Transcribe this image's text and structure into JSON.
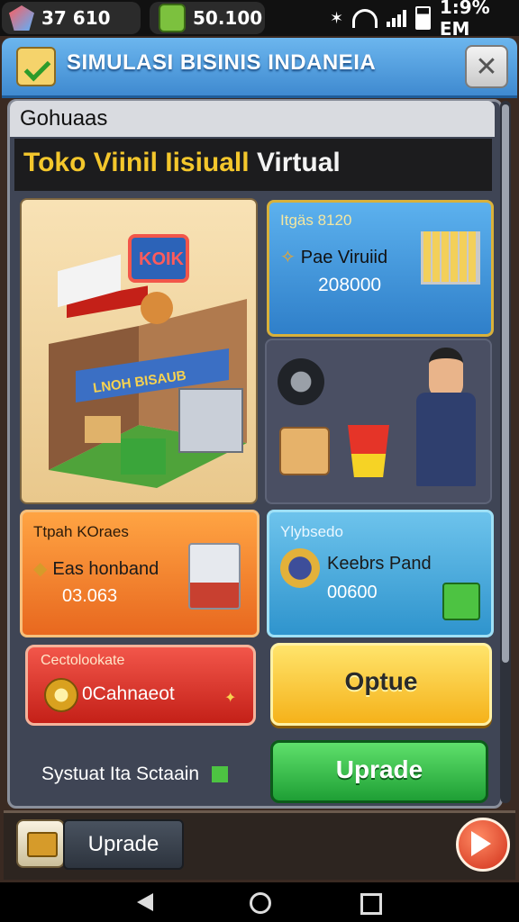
{
  "status_bar": {
    "left_value": "37 610",
    "coins_value": "50.100",
    "time": "1:9% EM"
  },
  "header": {
    "title": "SIMULASI BISINIS INDANEIA",
    "close_icon": "close-icon"
  },
  "panel": {
    "section_label": "Gohuaas",
    "banner_title_yellow": "Toko Viinil Iisiuall",
    "banner_title_white": " Virtual"
  },
  "shop_card": {
    "sign_text": "KOIK",
    "store_sign_text": "LNOH BISAUB"
  },
  "virtual_card": {
    "label": "Itgäs 8120",
    "name": "Pae Viruiid",
    "price": "208000"
  },
  "orange_card": {
    "label": "Ttpah KOraes",
    "name": "Eas honband",
    "value": "03.063"
  },
  "blue_card": {
    "label": "Ylybsedo",
    "name": "Keebrs Pand",
    "value": "00600"
  },
  "red_card": {
    "label": "Cectolookate",
    "name": "0Cahnaeot"
  },
  "buttons": {
    "option_label": "Optue",
    "upgrade_label": "Uprade",
    "bottom_upgrade_label": "Uprade"
  },
  "footer_status": "Systuat Ita Sctaain",
  "colors": {
    "header_blue": "#3f8ad0",
    "banner_yellow": "#f4c72c",
    "upgrade_green": "#1f9f35",
    "option_yellow": "#f5b21a",
    "red_card": "#c42018",
    "orange_card": "#e8681f",
    "blue_card": "#2f94cd"
  }
}
